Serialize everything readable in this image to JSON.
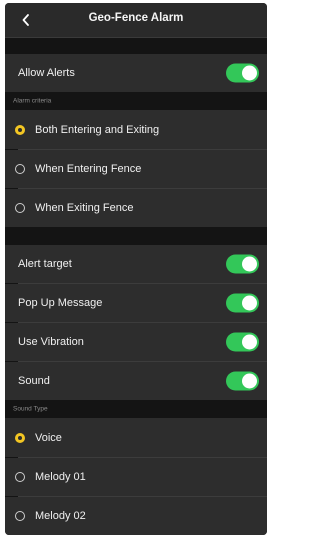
{
  "nav": {
    "back_icon": "chevron-left-icon",
    "title": "Geo-Fence Alarm"
  },
  "allow_alerts": {
    "label": "Allow Alerts",
    "on": true
  },
  "alarm_criteria": {
    "header": "Alarm criteria",
    "options": [
      {
        "label": "Both Entering and Exiting",
        "selected": true
      },
      {
        "label": "When Entering Fence",
        "selected": false
      },
      {
        "label": "When Exiting Fence",
        "selected": false
      }
    ]
  },
  "alerts": [
    {
      "label": "Alert target",
      "on": true
    },
    {
      "label": "Pop Up Message",
      "on": true
    },
    {
      "label": "Use Vibration",
      "on": true
    },
    {
      "label": "Sound",
      "on": true
    }
  ],
  "sound_type": {
    "header": "Sound Type",
    "options": [
      {
        "label": "Voice",
        "selected": true
      },
      {
        "label": "Melody 01",
        "selected": false
      },
      {
        "label": "Melody 02",
        "selected": false
      }
    ]
  },
  "colors": {
    "toggle_on": "#33c759",
    "radio_selected": "#f3c623",
    "row_background": "#2d2d2d",
    "page_background": "#141414"
  }
}
